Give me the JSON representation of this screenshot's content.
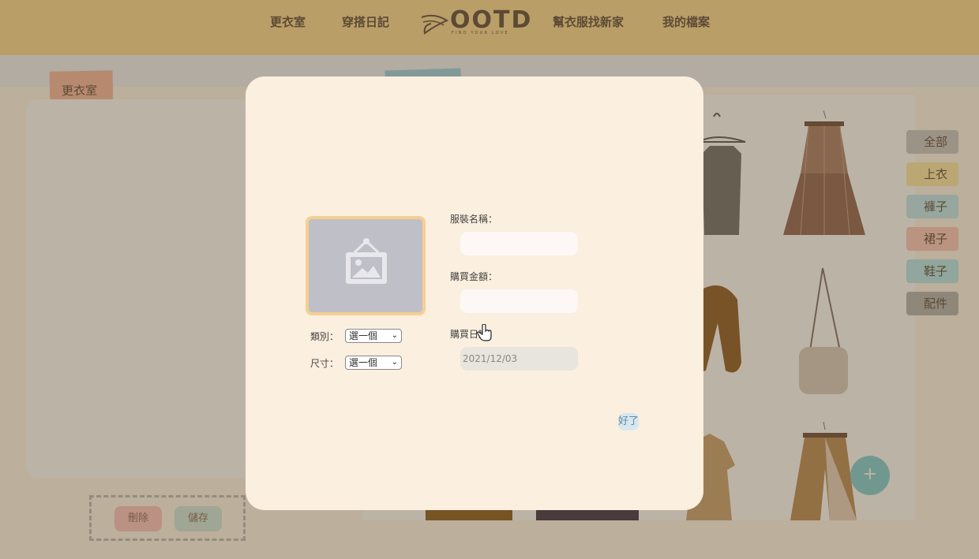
{
  "nav": {
    "items": [
      "更衣室",
      "穿搭日記",
      "幫衣服找新家",
      "我的檔案"
    ],
    "logo_text": "OOTD",
    "logo_sub": "FIND YOUR LOVE"
  },
  "closet": {
    "tag_label": "更衣室",
    "filters": [
      "全部",
      "上衣",
      "褲子",
      "裙子",
      "鞋子",
      "配件"
    ],
    "filter_colors": [
      "#c8c8c8",
      "#fdeba8",
      "#bfe8f0",
      "#fbc9bd",
      "#b5e8ec",
      "#b3b3b3"
    ],
    "delete_label": "刪除",
    "save_label": "儲存",
    "add_label": "+"
  },
  "modal": {
    "category_label": "類別：",
    "size_label": "尺寸：",
    "category_value": "選一個",
    "size_value": "選一個",
    "name_label": "服裝名稱：",
    "price_label": "購買金額：",
    "date_label": "購買日期：",
    "date_value": "2021/12/03",
    "ok_label": "好了"
  }
}
